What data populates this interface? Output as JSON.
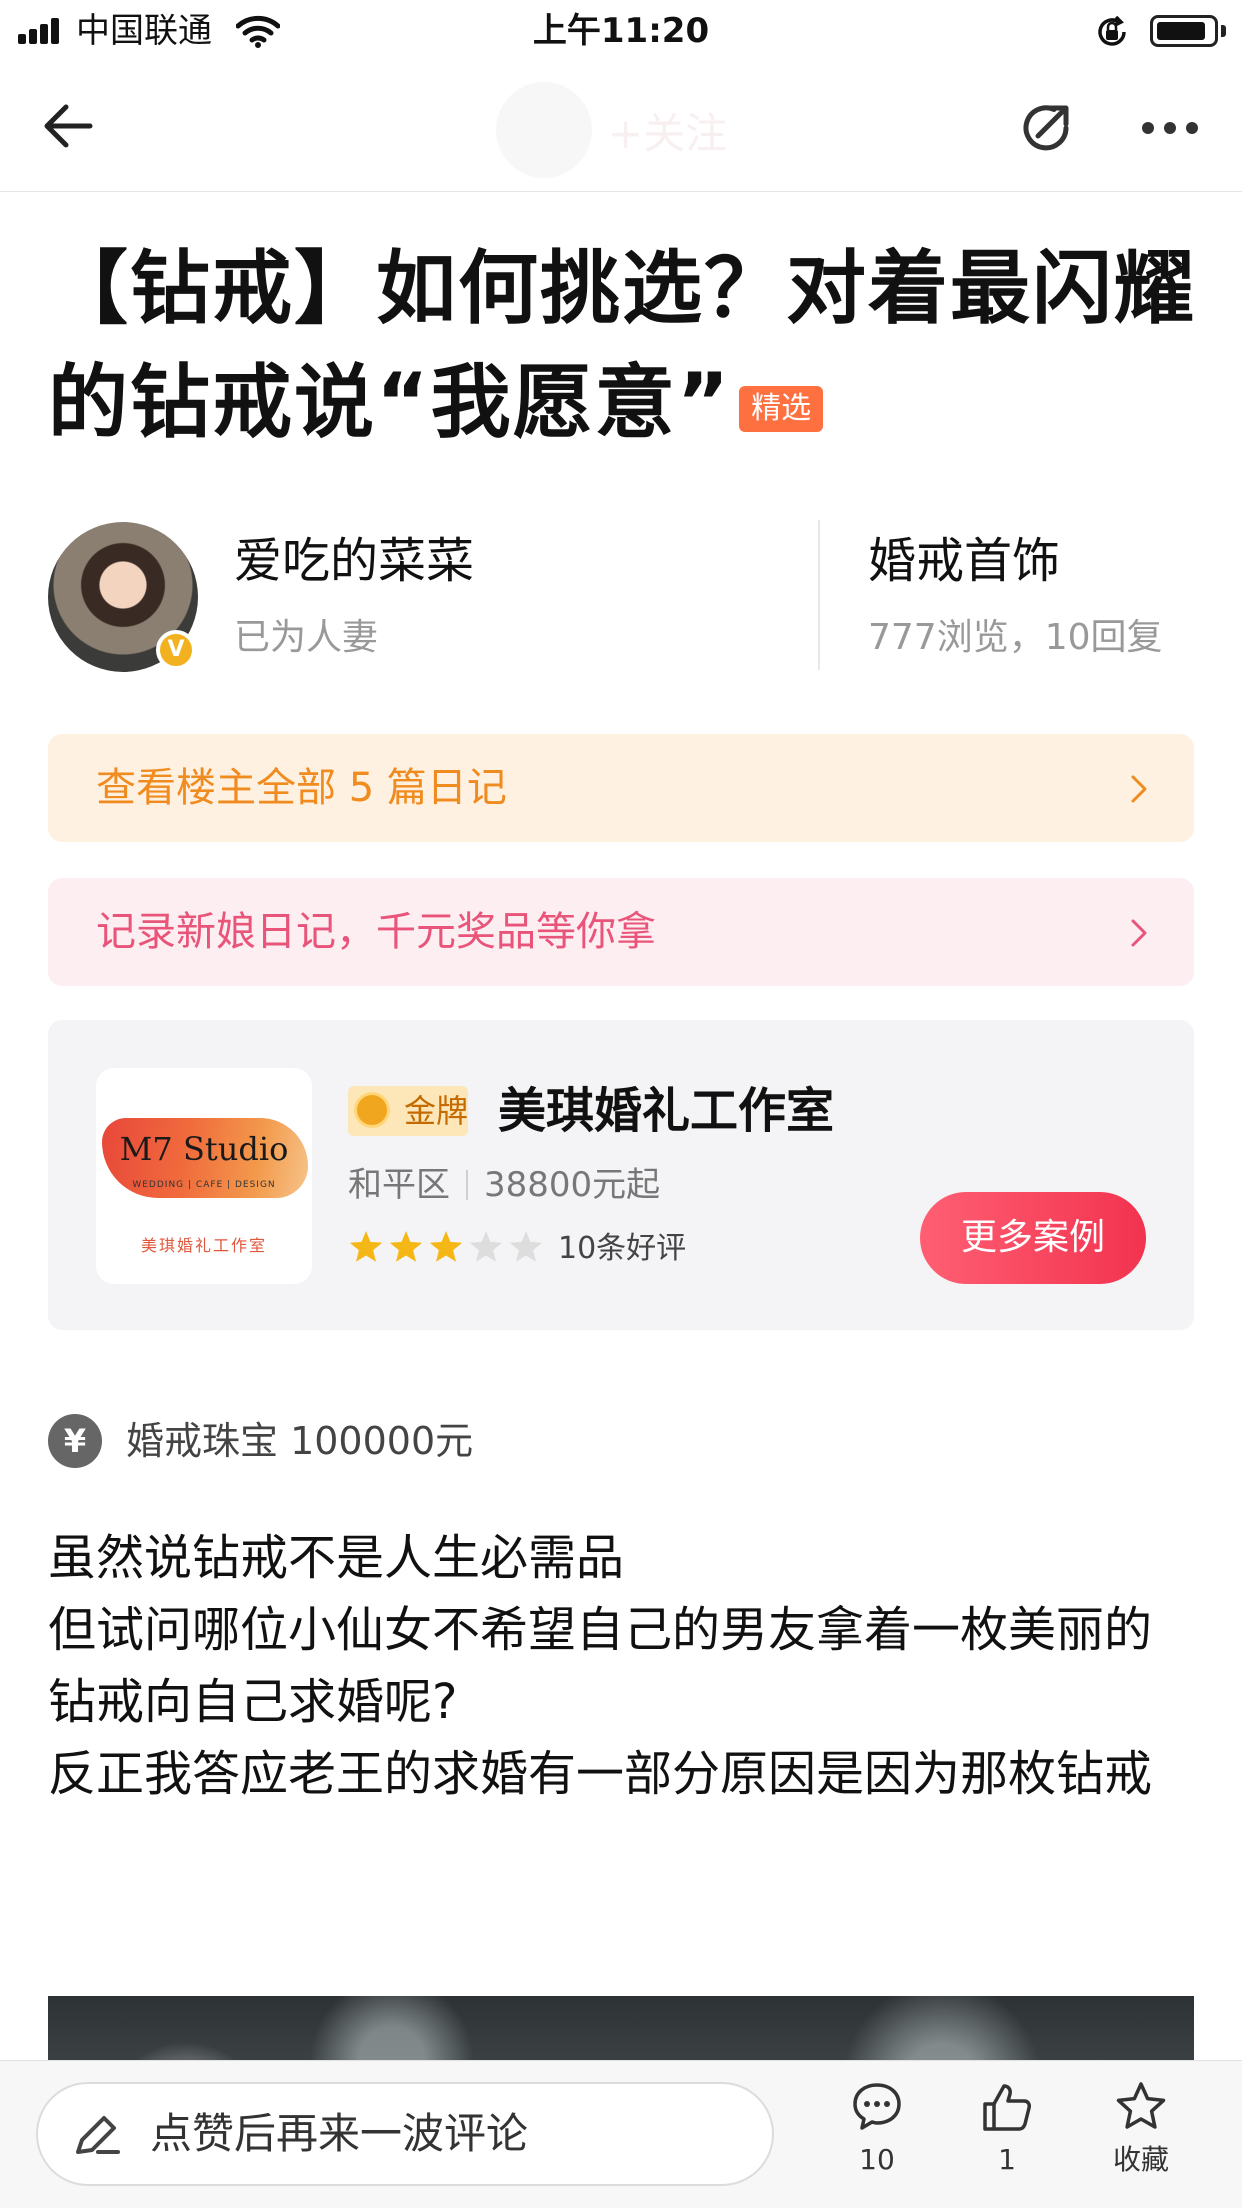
{
  "status_bar": {
    "carrier": "中国联通",
    "time": "上午11:20"
  },
  "nav": {
    "follow_label": "+关注"
  },
  "post": {
    "title": "【钻戒】如何挑选？对着最闪耀的钻戒说“我愿意”",
    "featured_badge": "精选"
  },
  "author": {
    "name": "爱吃的菜菜",
    "status": "已为人妻"
  },
  "category": {
    "name": "婚戒首饰",
    "stats": "777浏览，10回复"
  },
  "banners": {
    "diaries": "查看楼主全部 5 篇日记",
    "promo": "记录新娘日记，千元奖品等你拿"
  },
  "studio": {
    "logo_text": "M7 Studio",
    "logo_sub": "WEDDING | CAFE | DESIGN",
    "logo_cn": "美琪婚礼工作室",
    "medal": "金牌",
    "name": "美琪婚礼工作室",
    "district": "和平区",
    "price": "38800元起",
    "rating": 3,
    "rating_max": 5,
    "reviews": "10条好评",
    "cta": "更多案例"
  },
  "budget": {
    "icon": "¥",
    "text": "婚戒珠宝 100000元"
  },
  "body": {
    "p1": "虽然说钻戒不是人生必需品",
    "p2": "但试问哪位小仙女不希望自己的男友拿着一枚美丽的钻戒向自己求婚呢?",
    "p3": "反正我答应老王的求婚有一部分原因是因为那枚钻戒"
  },
  "bottom_bar": {
    "comment_placeholder": "点赞后再来一波评论",
    "comments_count": "10",
    "likes_count": "1",
    "favorite_label": "收藏"
  },
  "colors": {
    "accent_red": "#f2334f",
    "orange_banner_text": "#f08b1f",
    "pink_banner_text": "#e9557a",
    "featured_badge": "#ff7040",
    "star_filled": "#f5b716",
    "star_empty": "#dddddd"
  },
  "icons": {
    "back": "arrow-left-icon",
    "share": "share-icon",
    "more": "more-dots-icon",
    "comment": "comment-bubble-icon",
    "like": "thumb-up-icon",
    "favorite": "star-outline-icon",
    "pen": "pen-icon",
    "yen": "yen-icon",
    "chevron": "chevron-right-icon"
  }
}
